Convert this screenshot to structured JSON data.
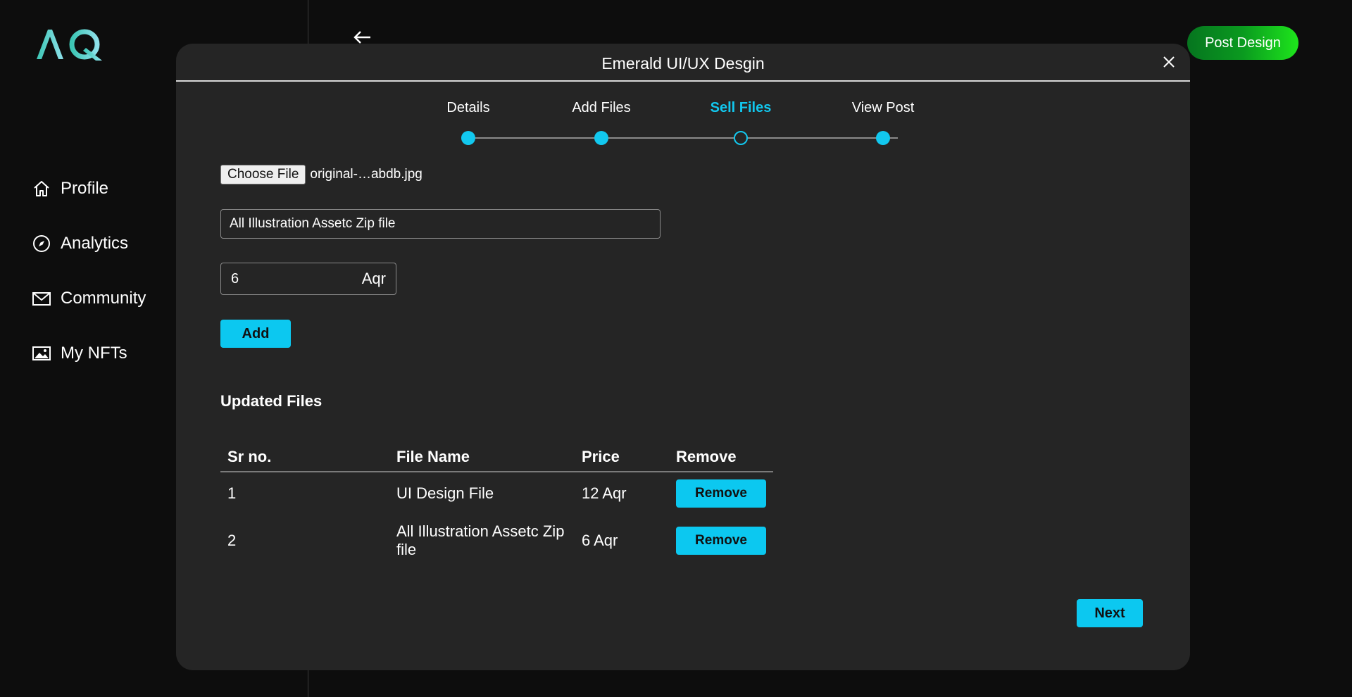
{
  "sidebar": {
    "logo_text": "AQ",
    "items": [
      {
        "label": "Profile",
        "icon": "home-icon"
      },
      {
        "label": "Analytics",
        "icon": "compass-icon"
      },
      {
        "label": "Community",
        "icon": "mail-icon"
      },
      {
        "label": "My NFTs",
        "icon": "image-icon"
      }
    ]
  },
  "header": {
    "back_icon": "arrow-left-icon",
    "post_design_label": "Post Design"
  },
  "modal": {
    "title": "Emerald UI/UX Desgin",
    "close_icon": "close-icon",
    "steps": [
      {
        "label": "Details",
        "state": "done"
      },
      {
        "label": "Add Files",
        "state": "done"
      },
      {
        "label": "Sell Files",
        "state": "active"
      },
      {
        "label": "View Post",
        "state": "done"
      }
    ],
    "file": {
      "choose_label": "Choose File",
      "file_name": "original-…abdb.jpg"
    },
    "title_input_value": "All Illustration Assetc Zip file",
    "price_value": "6",
    "price_unit": "Aqr",
    "add_label": "Add",
    "section_title": "Updated Files",
    "table": {
      "headers": [
        "Sr no.",
        "File Name",
        "Price",
        "Remove"
      ],
      "rows": [
        {
          "sr": "1",
          "file_name": "UI Design File",
          "price": "12 Aqr",
          "action": "Remove"
        },
        {
          "sr": "2",
          "file_name": "All Illustration Assetc Zip file",
          "price": "6 Aqr",
          "action": "Remove"
        }
      ]
    },
    "next_label": "Next"
  },
  "colors": {
    "accent": "#0cc8f0",
    "background": "#0d0d0d",
    "modal_bg": "#252525",
    "post_design_start": "#06751f",
    "post_design_end": "#1ee61c"
  }
}
